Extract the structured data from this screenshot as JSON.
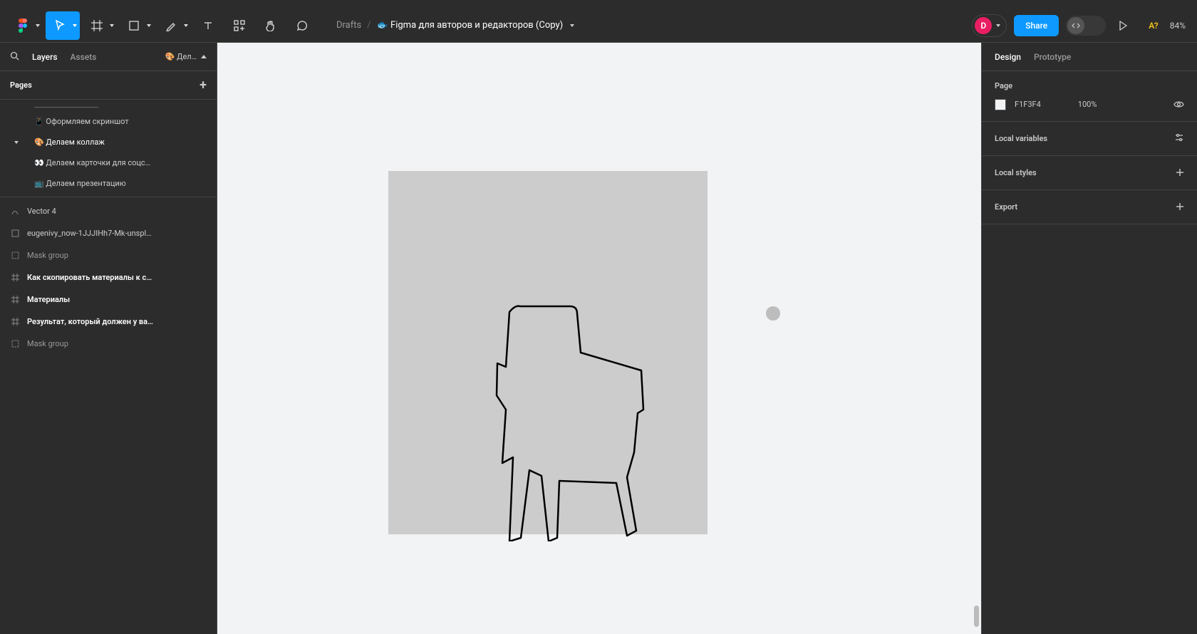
{
  "breadcrumb": {
    "drafts": "Drafts",
    "slash": "/",
    "filename": "🐟 Figma для авторов и редакторов (Copy)"
  },
  "toolbar": {
    "share": "Share",
    "zoom": "84%",
    "help": "A?",
    "avatar_initial": "D"
  },
  "left_panel": {
    "tabs": {
      "layers": "Layers",
      "assets": "Assets"
    },
    "page_dropdown": "🎨 Дел…",
    "pages_label": "Pages",
    "pages": [
      {
        "label": "📱 Оформляем скриншот"
      },
      {
        "label": "🎨 Делаем коллаж",
        "selected": true
      },
      {
        "label": "👀 Делаем карточки для соцс…"
      },
      {
        "label": "📺 Делаем презентацию"
      }
    ],
    "layers": [
      {
        "icon": "vector-icon",
        "label": "Vector 4",
        "style": "normal"
      },
      {
        "icon": "rect-icon",
        "label": "eugenivy_now-1JJJIHh7-Mk-unspl…",
        "style": "normal"
      },
      {
        "icon": "mask-icon",
        "label": "Mask group",
        "style": "muted"
      },
      {
        "icon": "frame-icon",
        "label": "Как скопировать материалы к с…",
        "style": "bold"
      },
      {
        "icon": "frame-icon",
        "label": "Материалы",
        "style": "bold"
      },
      {
        "icon": "frame-icon",
        "label": "Результат, который должен у ва…",
        "style": "bold"
      },
      {
        "icon": "mask-icon",
        "label": "Mask group",
        "style": "muted"
      }
    ]
  },
  "right_panel": {
    "tabs": {
      "design": "Design",
      "prototype": "Prototype"
    },
    "page_section": {
      "title": "Page",
      "color_hex": "F1F3F4",
      "opacity": "100%"
    },
    "local_variables": "Local variables",
    "local_styles": "Local styles",
    "export": "Export"
  },
  "colors": {
    "accent": "#0d99ff",
    "canvas": "#f1f3f4",
    "artboard": "#cccccc"
  }
}
